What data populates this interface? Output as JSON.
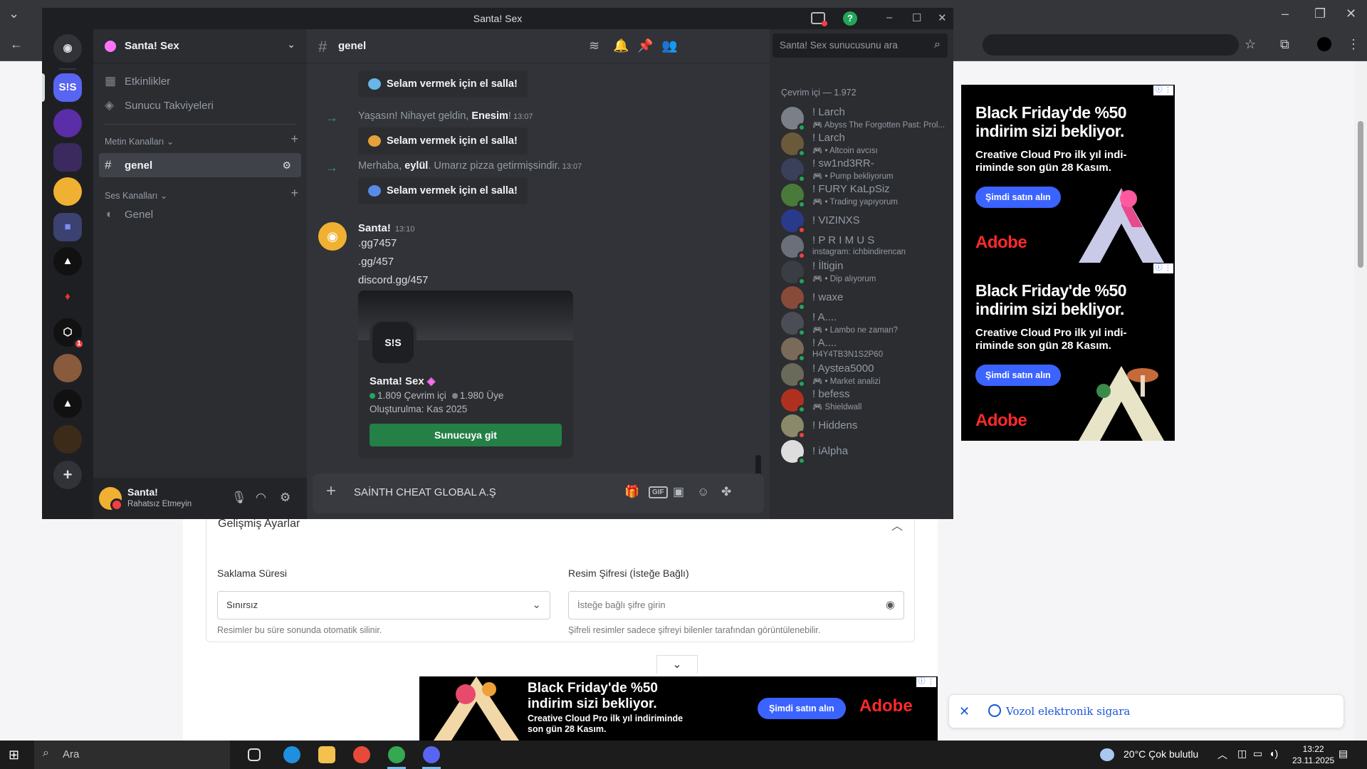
{
  "discord": {
    "window_title": "Santa! Sex",
    "server_name": "Santa! Sex",
    "rail": [
      {
        "name": "discord-home",
        "label": "",
        "color": "#5865f2"
      },
      {
        "name": "santa-sex",
        "label": "S!S",
        "color": "#5865f2"
      },
      {
        "name": "server-purple",
        "label": "",
        "color": "#5a2ea6"
      },
      {
        "name": "server-ge-klan",
        "label": "",
        "color": "#3a2a5e"
      },
      {
        "name": "server-avatar",
        "label": "",
        "color": "#f0b132"
      },
      {
        "name": "server-folder",
        "label": "",
        "color": "#3b4170"
      },
      {
        "name": "server-triangle",
        "label": "",
        "color": "#1e1f22"
      },
      {
        "name": "server-flame",
        "label": "",
        "color": "#1e1f22"
      },
      {
        "name": "server-hex",
        "label": "",
        "color": "#1e1f22",
        "badge": "1"
      },
      {
        "name": "server-photo",
        "label": "",
        "color": "#8a5a3c"
      },
      {
        "name": "server-triangle2",
        "label": "",
        "color": "#1e1f22"
      },
      {
        "name": "server-cazino",
        "label": "",
        "color": "#3d2b1a"
      },
      {
        "name": "add-server",
        "label": "+",
        "color": "#313338"
      }
    ],
    "sidebar": {
      "events": "Etkinlikler",
      "boosts": "Sunucu Takviyeleri",
      "text_category": "Metin Kanalları",
      "active_channel": "genel",
      "voice_category": "Ses Kanalları",
      "voice_channel": "Genel"
    },
    "user": {
      "name": "Santa!",
      "status": "Rahatsız Etmeyin"
    },
    "channel": {
      "name": "genel",
      "search_placeholder": "Santa! Sex sunucusunu ara"
    },
    "messages": {
      "wave_label": "Selam vermek için el salla!",
      "sys1": {
        "pre": "Yaşasın! Nihayet geldin, ",
        "user": "Enesim",
        "post": "!",
        "time": "13:07"
      },
      "sys2": {
        "pre": "Merhaba, ",
        "user": "eylül",
        "post": ". Umarız pizza getirmişsindir.",
        "time": "13:07"
      },
      "author": "Santa!",
      "author_time": "13:10",
      "lines": [
        ".gg7457",
        ".gg/457",
        "discord.gg/457"
      ]
    },
    "invite": {
      "icon_text": "S!S",
      "name": "Santa! Sex",
      "online": "1.809 Çevrim içi",
      "members": "1.980 Üye",
      "created": "Oluşturulma: Kas 2025",
      "join_label": "Sunucuya git"
    },
    "composer": {
      "value": "SAİNTH CHEAT GLOBAL A.Ş"
    },
    "members": {
      "category": "Çevrim içi — 1.972",
      "list": [
        {
          "name": "! Larch",
          "sub": "🎮 Abyss The Forgotten Past: Prol...",
          "status": "#23a55a",
          "color": "#7a7f88"
        },
        {
          "name": "! Larch",
          "sub": "🎮 • Altcoin avcısı",
          "status": "#23a55a",
          "color": "#6b5a3a"
        },
        {
          "name": "! sw1nd3RR-",
          "sub": "🎮 • Pump bekliyorum",
          "status": "#23a55a",
          "color": "#3a3f5a"
        },
        {
          "name": "! FURY KaLpSiz",
          "sub": "🎮 • Trading yapıyorum",
          "status": "#23a55a",
          "color": "#4a7a3a"
        },
        {
          "name": "! VIZINXS",
          "sub": "",
          "status": "#f23f43",
          "color": "#2a3a8a"
        },
        {
          "name": "! P R I M U S",
          "sub": "instagram: ichbindirencan",
          "status": "#f23f43",
          "color": "#6a6f7a"
        },
        {
          "name": "! İltigin",
          "sub": "🎮 • Dip alıyorum",
          "status": "#23a55a",
          "color": "#3a3d44"
        },
        {
          "name": "! waxe",
          "sub": "",
          "status": "#23a55a",
          "color": "#8a4a3a"
        },
        {
          "name": "! A....",
          "sub": "🎮 • Lambo ne zaman?",
          "status": "#23a55a",
          "color": "#4a4d55"
        },
        {
          "name": "! A....",
          "sub": "H4Y4TB3N1S2P60",
          "status": "#23a55a",
          "color": "#7a6a5a"
        },
        {
          "name": "! Aystea5000",
          "sub": "🎮 • Market analizi",
          "status": "#23a55a",
          "color": "#6a6a5a"
        },
        {
          "name": "! befess",
          "sub": "🎮 Shieldwall",
          "status": "#23a55a",
          "color": "#b03020"
        },
        {
          "name": "! Hiddens",
          "sub": "",
          "status": "#f23f43",
          "color": "#8a8a6a"
        },
        {
          "name": "! iAlpha",
          "sub": "",
          "status": "#23a55a",
          "color": "#ddd"
        }
      ]
    }
  },
  "webpage": {
    "advanced_title": "Gelişmiş Ayarlar",
    "retention_label": "Saklama Süresi",
    "retention_value": "Sınırsız",
    "retention_hint": "Resimler bu süre sonunda otomatik silinir.",
    "password_label": "Resim Şifresi (İsteğe Bağlı)",
    "password_placeholder": "İsteğe bağlı şifre girin",
    "password_hint": "Şifreli resimler sadece şifreyi bilenler tarafından görüntülenebilir."
  },
  "ads": {
    "headline": "Black Friday'de %50 indirim sizi bekliyor.",
    "sub": "Creative Cloud Pro ilk yıl indi- riminde son gün 28 Kasım.",
    "bottom_sub": "Creative Cloud Pro ilk yıl indiriminde son gün 28 Kasım.",
    "cta": "Şimdi satın alın",
    "brand": "Adobe"
  },
  "notification": {
    "text": "Vozol elektronik sigara"
  },
  "taskbar": {
    "search": "Ara",
    "weather": "20°C  Çok bulutlu",
    "time": "13:22",
    "date": "23.11.2025"
  }
}
